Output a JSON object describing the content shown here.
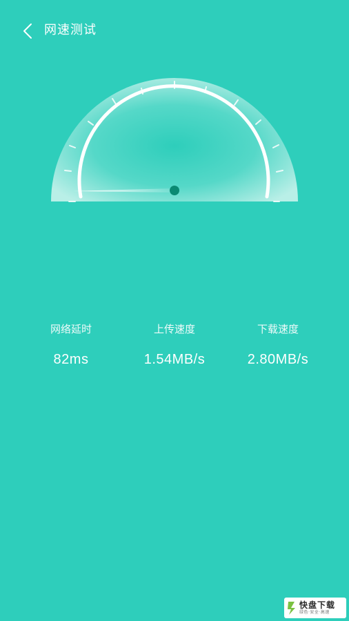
{
  "header": {
    "title": "网速测试",
    "back_icon": "chevron-left-icon"
  },
  "theme": {
    "background": "#2ecebb",
    "accent_dark": "#0b8a73",
    "text": "#ffffff"
  },
  "gauge": {
    "needle_icon": "speed-needle",
    "level": 0.0
  },
  "stats": [
    {
      "label": "网络延时",
      "value": "82ms"
    },
    {
      "label": "上传速度",
      "value": "1.54MB/s"
    },
    {
      "label": "下载速度",
      "value": "2.80MB/s"
    }
  ],
  "watermark": {
    "main": "快盘下载",
    "sub": "绿色·安全·高速"
  }
}
